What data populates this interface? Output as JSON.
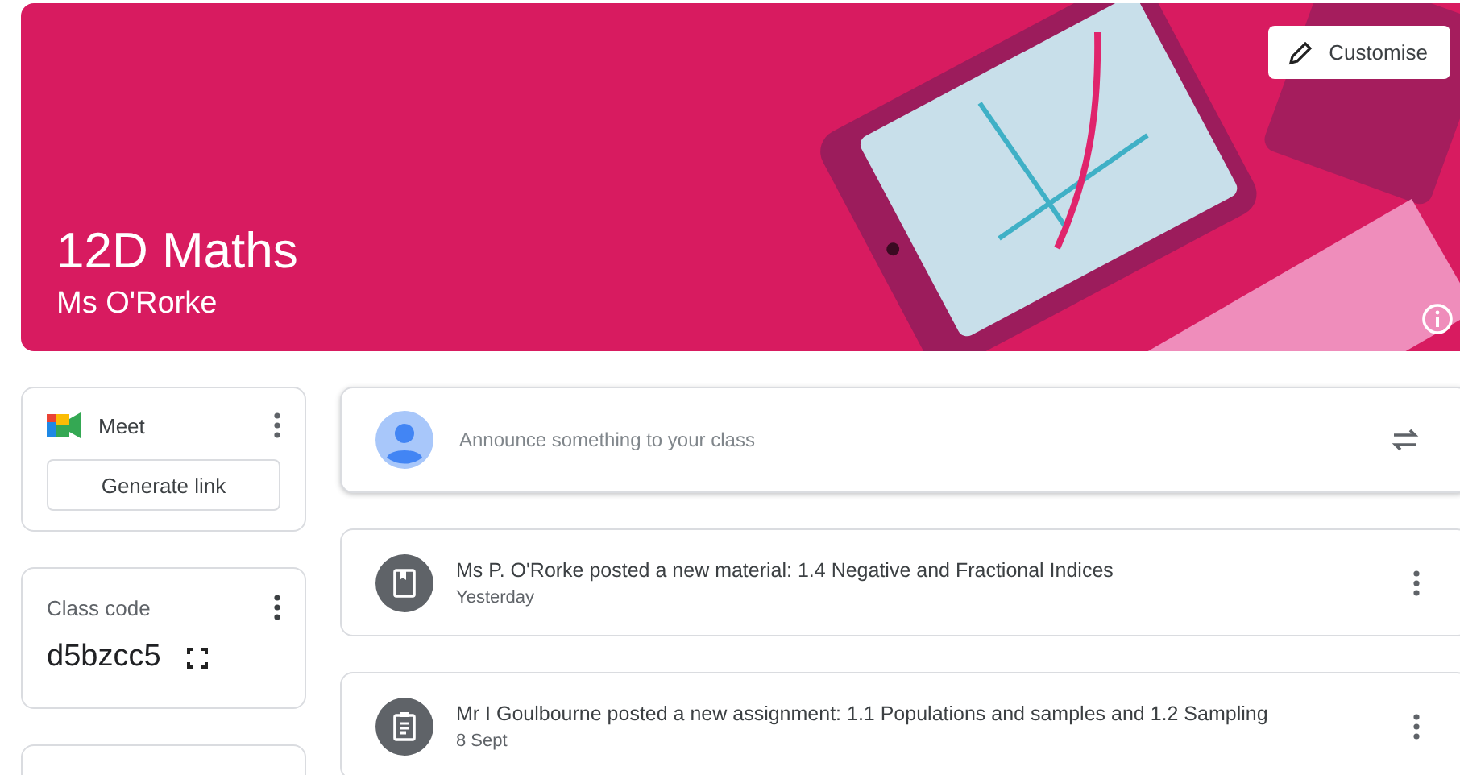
{
  "banner": {
    "title": "12D Maths",
    "subtitle": "Ms O'Rorke",
    "customise_button": "Customise"
  },
  "meet": {
    "label": "Meet",
    "button": "Generate link"
  },
  "class_code": {
    "label": "Class code",
    "code": "d5bzcc5"
  },
  "announce": {
    "placeholder": "Announce something to your class"
  },
  "posts": [
    {
      "kind": "material",
      "text": "Ms P. O'Rorke posted a new material: 1.4 Negative and Fractional Indices",
      "date": "Yesterday"
    },
    {
      "kind": "assignment",
      "text": "Mr I Goulbourne posted a new assignment: 1.1 Populations and samples and 1.2 Sampling",
      "date": "8 Sept"
    }
  ]
}
